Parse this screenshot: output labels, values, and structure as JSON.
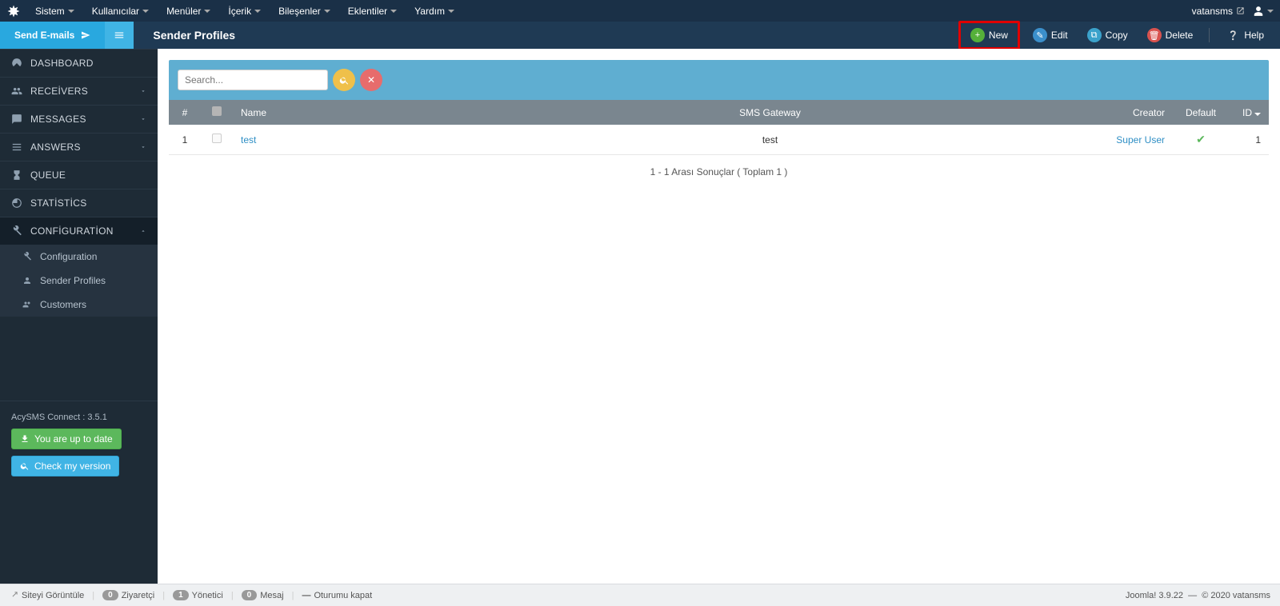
{
  "topbar": {
    "menus": [
      "Sistem",
      "Kullanıcılar",
      "Menüler",
      "İçerik",
      "Bileşenler",
      "Eklentiler",
      "Yardım"
    ],
    "site_name": "vatansms"
  },
  "actionbar": {
    "send_emails": "Send E-mails",
    "page_title": "Sender Profiles",
    "new": "New",
    "edit": "Edit",
    "copy": "Copy",
    "delete": "Delete",
    "help": "Help"
  },
  "sidebar": {
    "items": [
      {
        "label": "DASHBOARD",
        "expandable": false
      },
      {
        "label": "RECEİVERS",
        "expandable": true
      },
      {
        "label": "MESSAGES",
        "expandable": true
      },
      {
        "label": "ANSWERS",
        "expandable": true
      },
      {
        "label": "QUEUE",
        "expandable": false
      },
      {
        "label": "STATİSTİCS",
        "expandable": false
      },
      {
        "label": "CONFİGURATİON",
        "expandable": true,
        "open": true
      }
    ],
    "sub_items": [
      "Configuration",
      "Sender Profiles",
      "Customers"
    ],
    "version_text": "AcySMS Connect : 3.5.1",
    "up_to_date": "You are up to date",
    "check_version": "Check my version"
  },
  "search": {
    "placeholder": "Search..."
  },
  "table": {
    "headers": {
      "num": "#",
      "name": "Name",
      "gateway": "SMS Gateway",
      "creator": "Creator",
      "default": "Default",
      "id": "ID"
    },
    "rows": [
      {
        "num": "1",
        "name": "test",
        "gateway": "test",
        "creator": "Super User",
        "default": true,
        "id": "1"
      }
    ],
    "pagination": "1 - 1 Arası Sonuçlar ( Toplam 1 )"
  },
  "footer": {
    "view_site": "Siteyi Görüntüle",
    "visitors_count": "0",
    "visitors_label": "Ziyaretçi",
    "admins_count": "1",
    "admins_label": "Yönetici",
    "messages_count": "0",
    "messages_label": "Mesaj",
    "logout": "Oturumu kapat",
    "joomla_version": "Joomla! 3.9.22",
    "copyright": "© 2020 vatansms"
  }
}
